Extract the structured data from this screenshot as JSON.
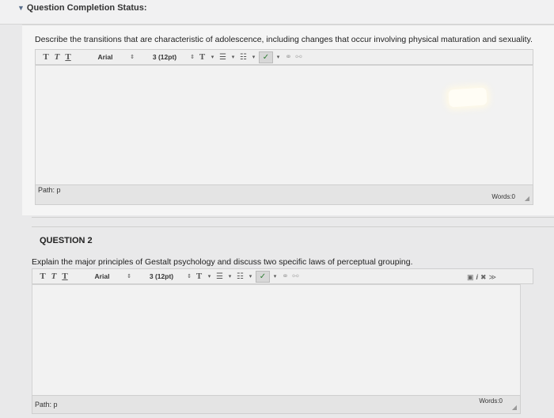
{
  "status": {
    "label": "Question Completion Status:"
  },
  "questions": [
    {
      "heading": "",
      "prompt": "Describe the transitions that are characteristic of adolescence, including changes that occur involving physical maturation and sexuality.",
      "toolbar": {
        "font": "Arial",
        "size": "3 (12pt)"
      },
      "path": "Path: p",
      "words": "Words:0"
    },
    {
      "heading": "QUESTION 2",
      "prompt": "Explain the major principles of Gestalt psychology and discuss two specific laws of perceptual grouping.",
      "toolbar": {
        "font": "Arial",
        "size": "3 (12pt)"
      },
      "path": "Path: p",
      "words": "Words:0"
    }
  ],
  "icons": {
    "format_t": "T",
    "spinner": "⇕",
    "text_color": "T",
    "bullets": "☰",
    "numbered": "☷",
    "dropdown": "▾",
    "spellcheck": "✓",
    "link": "⚭",
    "unlink": "⚯",
    "resize": "◢"
  }
}
